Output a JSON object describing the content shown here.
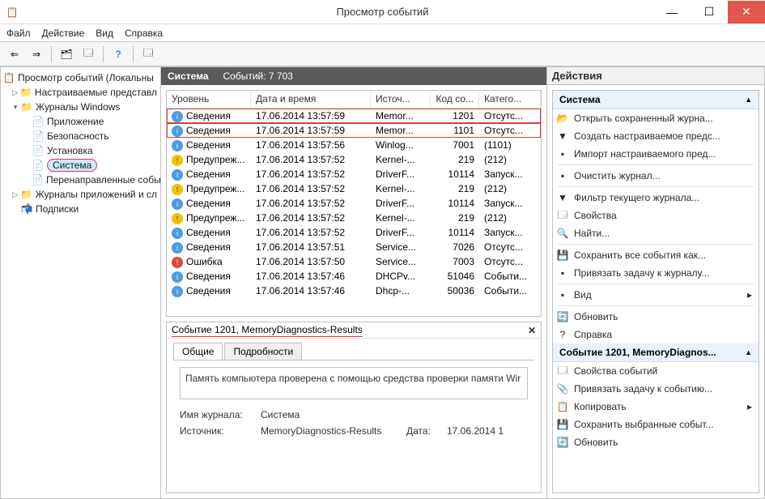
{
  "window": {
    "title": "Просмотр событий"
  },
  "menu": {
    "items": [
      "Файл",
      "Действие",
      "Вид",
      "Справка"
    ]
  },
  "tree": {
    "root": "Просмотр событий (Локальны",
    "custom": "Настраиваемые представл",
    "winlogs": "Журналы Windows",
    "winlogs_children": [
      "Приложение",
      "Безопасность",
      "Установка",
      "Система",
      "Перенаправленные собы"
    ],
    "applogs": "Журналы приложений и сл",
    "subs": "Подписки"
  },
  "center": {
    "header_name": "Система",
    "header_count_label": "Событий: 7 703",
    "columns": [
      "Уровень",
      "Дата и время",
      "Источ...",
      "Код со...",
      "Катего..."
    ],
    "events": [
      {
        "t": "info",
        "level": "Сведения",
        "date": "17.06.2014 13:57:59",
        "src": "Memor...",
        "code": "1201",
        "cat": "Отсутс...",
        "hl": true
      },
      {
        "t": "info",
        "level": "Сведения",
        "date": "17.06.2014 13:57:59",
        "src": "Memor...",
        "code": "1101",
        "cat": "Отсутс...",
        "hl": true
      },
      {
        "t": "info",
        "level": "Сведения",
        "date": "17.06.2014 13:57:56",
        "src": "Winlog...",
        "code": "7001",
        "cat": "(1101)"
      },
      {
        "t": "warn",
        "level": "Предупреж...",
        "date": "17.06.2014 13:57:52",
        "src": "Kernel-...",
        "code": "219",
        "cat": "(212)"
      },
      {
        "t": "info",
        "level": "Сведения",
        "date": "17.06.2014 13:57:52",
        "src": "DriverF...",
        "code": "10114",
        "cat": "Запуск..."
      },
      {
        "t": "warn",
        "level": "Предупреж...",
        "date": "17.06.2014 13:57:52",
        "src": "Kernel-...",
        "code": "219",
        "cat": "(212)"
      },
      {
        "t": "info",
        "level": "Сведения",
        "date": "17.06.2014 13:57:52",
        "src": "DriverF...",
        "code": "10114",
        "cat": "Запуск..."
      },
      {
        "t": "warn",
        "level": "Предупреж...",
        "date": "17.06.2014 13:57:52",
        "src": "Kernel-...",
        "code": "219",
        "cat": "(212)"
      },
      {
        "t": "info",
        "level": "Сведения",
        "date": "17.06.2014 13:57:52",
        "src": "DriverF...",
        "code": "10114",
        "cat": "Запуск..."
      },
      {
        "t": "info",
        "level": "Сведения",
        "date": "17.06.2014 13:57:51",
        "src": "Service...",
        "code": "7026",
        "cat": "Отсутс..."
      },
      {
        "t": "error",
        "level": "Ошибка",
        "date": "17.06.2014 13:57:50",
        "src": "Service...",
        "code": "7003",
        "cat": "Отсутс..."
      },
      {
        "t": "info",
        "level": "Сведения",
        "date": "17.06.2014 13:57:46",
        "src": "DHCPv...",
        "code": "51046",
        "cat": "Событи..."
      },
      {
        "t": "info",
        "level": "Сведения",
        "date": "17.06.2014 13:57:46",
        "src": "Dhcp-...",
        "code": "50036",
        "cat": "Событи..."
      }
    ]
  },
  "detail": {
    "title": "Событие 1201, MemoryDiagnostics-Results",
    "tabs": [
      "Общие",
      "Подробности"
    ],
    "message": "Память компьютера проверена с помощью средства проверки памяти Wir",
    "log_label": "Имя журнала:",
    "log_value": "Система",
    "src_label": "Источник:",
    "src_value": "MemoryDiagnostics-Results",
    "date_label": "Дата:",
    "date_value": "17.06.2014 1"
  },
  "actions": {
    "title": "Действия",
    "section1": "Система",
    "items1": [
      {
        "icon": "open",
        "label": "Открыть сохраненный журна..."
      },
      {
        "icon": "create",
        "label": "Создать настраиваемое предс..."
      },
      {
        "icon": "import",
        "label": "Импорт настраиваемого пред..."
      },
      {
        "icon": "clear",
        "label": "Очистить журнал..."
      },
      {
        "icon": "filter",
        "label": "Фильтр текущего журнала..."
      },
      {
        "icon": "props",
        "label": "Свойства"
      },
      {
        "icon": "find",
        "label": "Найти..."
      },
      {
        "icon": "save",
        "label": "Сохранить все события как..."
      },
      {
        "icon": "attach",
        "label": "Привязать задачу к журналу..."
      },
      {
        "icon": "view",
        "label": "Вид"
      },
      {
        "icon": "refresh",
        "label": "Обновить"
      },
      {
        "icon": "help",
        "label": "Справка"
      }
    ],
    "section2": "Событие 1201, MemoryDiagnos...",
    "items2": [
      {
        "icon": "evprops",
        "label": "Свойства событий"
      },
      {
        "icon": "evattach",
        "label": "Привязать задачу к событию..."
      },
      {
        "icon": "copy",
        "label": "Копировать"
      },
      {
        "icon": "savesel",
        "label": "Сохранить выбранные событ..."
      },
      {
        "icon": "refresh",
        "label": "Обновить"
      }
    ]
  }
}
